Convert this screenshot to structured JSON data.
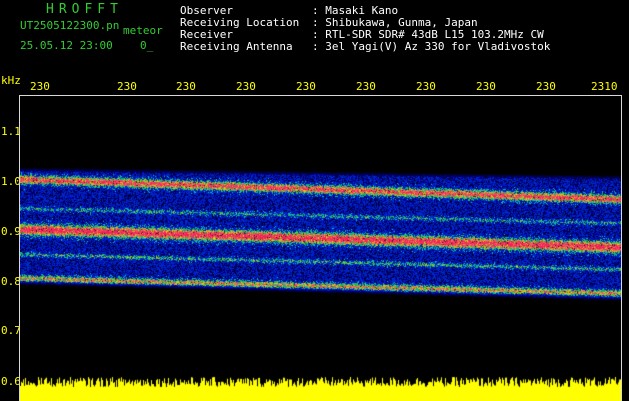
{
  "header": {
    "logo": "HROFFT",
    "filename": "UT2505122300.pn",
    "subtitle": "meteor",
    "datetime": "25.05.12 23:00",
    "datetime_suffix": "0_",
    "fields": [
      {
        "label": "Observer",
        "value": ": Masaki Kano"
      },
      {
        "label": "Receiving Location",
        "value": ": Shibukawa, Gunma, Japan"
      },
      {
        "label": "Receiver",
        "value": ": RTL-SDR SDR# 43dB L15 103.2MHz CW"
      },
      {
        "label": "Receiving Antenna",
        "value": ": 3el Yagi(V) Az 330 for Vladivostok"
      }
    ]
  },
  "axis": {
    "y_unit": "kHz",
    "x_ticks": [
      "230",
      "230",
      "230",
      "230",
      "230",
      "230",
      "230",
      "230",
      "230",
      "2310"
    ],
    "y_ticks": [
      "1.1",
      "1.0",
      "0.9",
      "0.8",
      "0.7",
      "0.6"
    ]
  },
  "colors": {
    "background": "#000000",
    "noise": "#0a1aa0",
    "band_core": "#ff3030",
    "band_mid": "#30d040",
    "ticks": "#ffff00",
    "logo": "#33cc33",
    "amplitude": "#ffff00"
  }
}
